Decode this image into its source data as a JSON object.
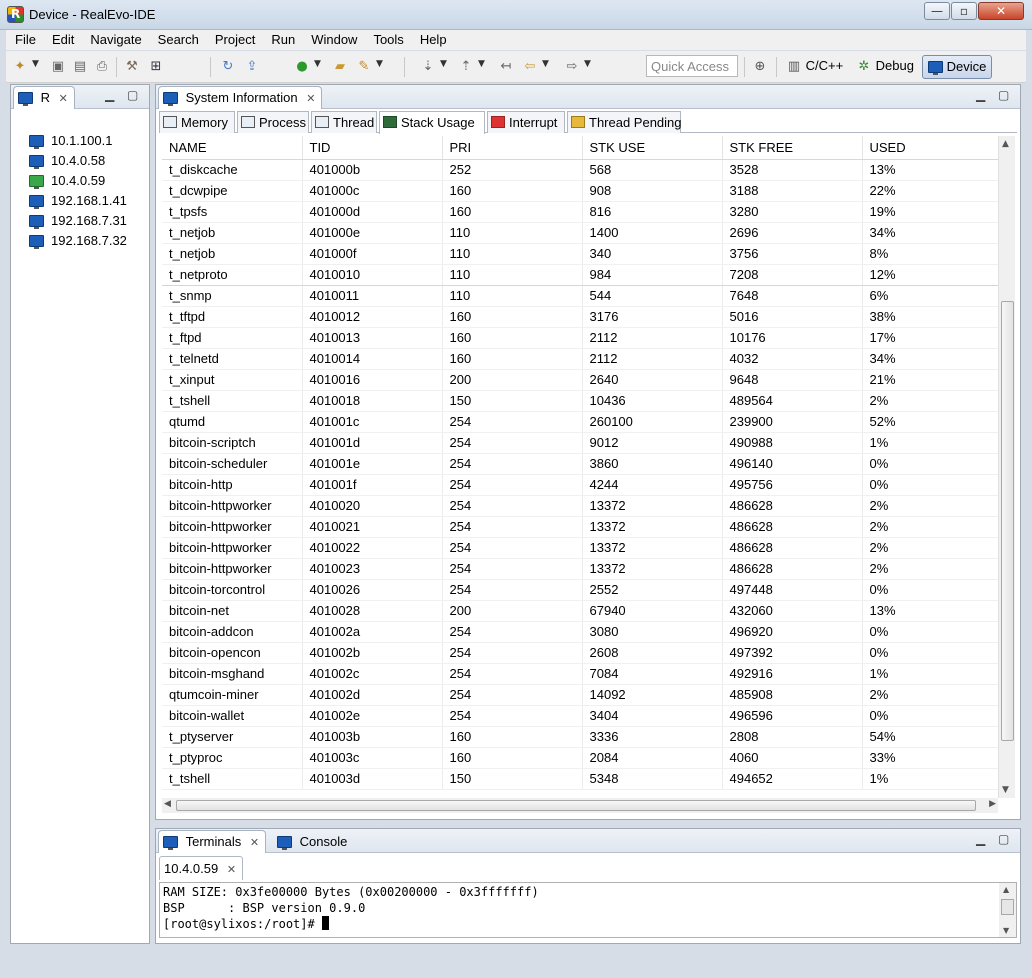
{
  "window": {
    "title": "Device - RealEvo-IDE",
    "minimize": "—",
    "maximize": "▫",
    "close": "✕"
  },
  "menu": [
    "File",
    "Edit",
    "Navigate",
    "Search",
    "Project",
    "Run",
    "Window",
    "Tools",
    "Help"
  ],
  "toolbar": {
    "quick_access_placeholder": "Quick Access",
    "perspectives": [
      {
        "label": "C/C++",
        "icon": "cpp-perspective-icon"
      },
      {
        "label": "Debug",
        "icon": "bug-icon"
      },
      {
        "label": "Device",
        "icon": "device-icon",
        "active": true
      }
    ]
  },
  "device_view": {
    "tab_label": "R",
    "devices": [
      {
        "ip": "10.1.100.1",
        "status": "normal"
      },
      {
        "ip": "10.4.0.58",
        "status": "normal"
      },
      {
        "ip": "10.4.0.59",
        "status": "connected"
      },
      {
        "ip": "192.168.1.41",
        "status": "normal"
      },
      {
        "ip": "192.168.7.31",
        "status": "normal"
      },
      {
        "ip": "192.168.7.32",
        "status": "normal"
      }
    ]
  },
  "system_info": {
    "tab_label": "System Information",
    "subtabs": [
      {
        "label": "Memory",
        "icon": "memory-icon"
      },
      {
        "label": "Process",
        "icon": "process-icon"
      },
      {
        "label": "Thread",
        "icon": "thread-icon"
      },
      {
        "label": "Stack Usage",
        "icon": "stack-icon",
        "active": true
      },
      {
        "label": "Interrupt",
        "icon": "interrupt-icon"
      },
      {
        "label": "Thread Pending",
        "icon": "lock-icon"
      }
    ],
    "columns": [
      "NAME",
      "TID",
      "PRI",
      "STK USE",
      "STK FREE",
      "USED"
    ],
    "rows": [
      [
        "t_diskcache",
        "401000b",
        "252",
        "568",
        "3528",
        "13%"
      ],
      [
        "t_dcwpipe",
        "401000c",
        "160",
        "908",
        "3188",
        "22%"
      ],
      [
        "t_tpsfs",
        "401000d",
        "160",
        "816",
        "3280",
        "19%"
      ],
      [
        "t_netjob",
        "401000e",
        "110",
        "1400",
        "2696",
        "34%"
      ],
      [
        "t_netjob",
        "401000f",
        "110",
        "340",
        "3756",
        "8%"
      ],
      [
        "t_netproto",
        "4010010",
        "110",
        "984",
        "7208",
        "12%"
      ],
      [
        "t_snmp",
        "4010011",
        "110",
        "544",
        "7648",
        "6%"
      ],
      [
        "t_tftpd",
        "4010012",
        "160",
        "3176",
        "5016",
        "38%"
      ],
      [
        "t_ftpd",
        "4010013",
        "160",
        "2112",
        "10176",
        "17%"
      ],
      [
        "t_telnetd",
        "4010014",
        "160",
        "2112",
        "4032",
        "34%"
      ],
      [
        "t_xinput",
        "4010016",
        "200",
        "2640",
        "9648",
        "21%"
      ],
      [
        "t_tshell",
        "4010018",
        "150",
        "10436",
        "489564",
        "2%"
      ],
      [
        "qtumd",
        "401001c",
        "254",
        "260100",
        "239900",
        "52%"
      ],
      [
        "bitcoin-scriptch",
        "401001d",
        "254",
        "9012",
        "490988",
        "1%"
      ],
      [
        "bitcoin-scheduler",
        "401001e",
        "254",
        "3860",
        "496140",
        "0%"
      ],
      [
        "bitcoin-http",
        "401001f",
        "254",
        "4244",
        "495756",
        "0%"
      ],
      [
        "bitcoin-httpworker",
        "4010020",
        "254",
        "13372",
        "486628",
        "2%"
      ],
      [
        "bitcoin-httpworker",
        "4010021",
        "254",
        "13372",
        "486628",
        "2%"
      ],
      [
        "bitcoin-httpworker",
        "4010022",
        "254",
        "13372",
        "486628",
        "2%"
      ],
      [
        "bitcoin-httpworker",
        "4010023",
        "254",
        "13372",
        "486628",
        "2%"
      ],
      [
        "bitcoin-torcontrol",
        "4010026",
        "254",
        "2552",
        "497448",
        "0%"
      ],
      [
        "bitcoin-net",
        "4010028",
        "200",
        "67940",
        "432060",
        "13%"
      ],
      [
        "bitcoin-addcon",
        "401002a",
        "254",
        "3080",
        "496920",
        "0%"
      ],
      [
        "bitcoin-opencon",
        "401002b",
        "254",
        "2608",
        "497392",
        "0%"
      ],
      [
        "bitcoin-msghand",
        "401002c",
        "254",
        "7084",
        "492916",
        "1%"
      ],
      [
        "qtumcoin-miner",
        "401002d",
        "254",
        "14092",
        "485908",
        "2%"
      ],
      [
        "bitcoin-wallet",
        "401002e",
        "254",
        "3404",
        "496596",
        "0%"
      ],
      [
        "t_ptyserver",
        "401003b",
        "160",
        "3336",
        "2808",
        "54%"
      ],
      [
        "t_ptyproc",
        "401003c",
        "160",
        "2084",
        "4060",
        "33%"
      ],
      [
        "t_tshell",
        "401003d",
        "150",
        "5348",
        "494652",
        "1%"
      ]
    ],
    "selected_row": 5
  },
  "bottom": {
    "tabs": [
      {
        "label": "Terminals",
        "icon": "terminal-icon",
        "active": true
      },
      {
        "label": "Console",
        "icon": "console-icon"
      }
    ],
    "session_tab": "10.4.0.59",
    "lines": [
      "RAM SIZE: 0x3fe00000 Bytes (0x00200000 - 0x3fffffff)",
      "BSP      : BSP version 0.9.0"
    ],
    "prompt": "[root@sylixos:/root]# "
  }
}
